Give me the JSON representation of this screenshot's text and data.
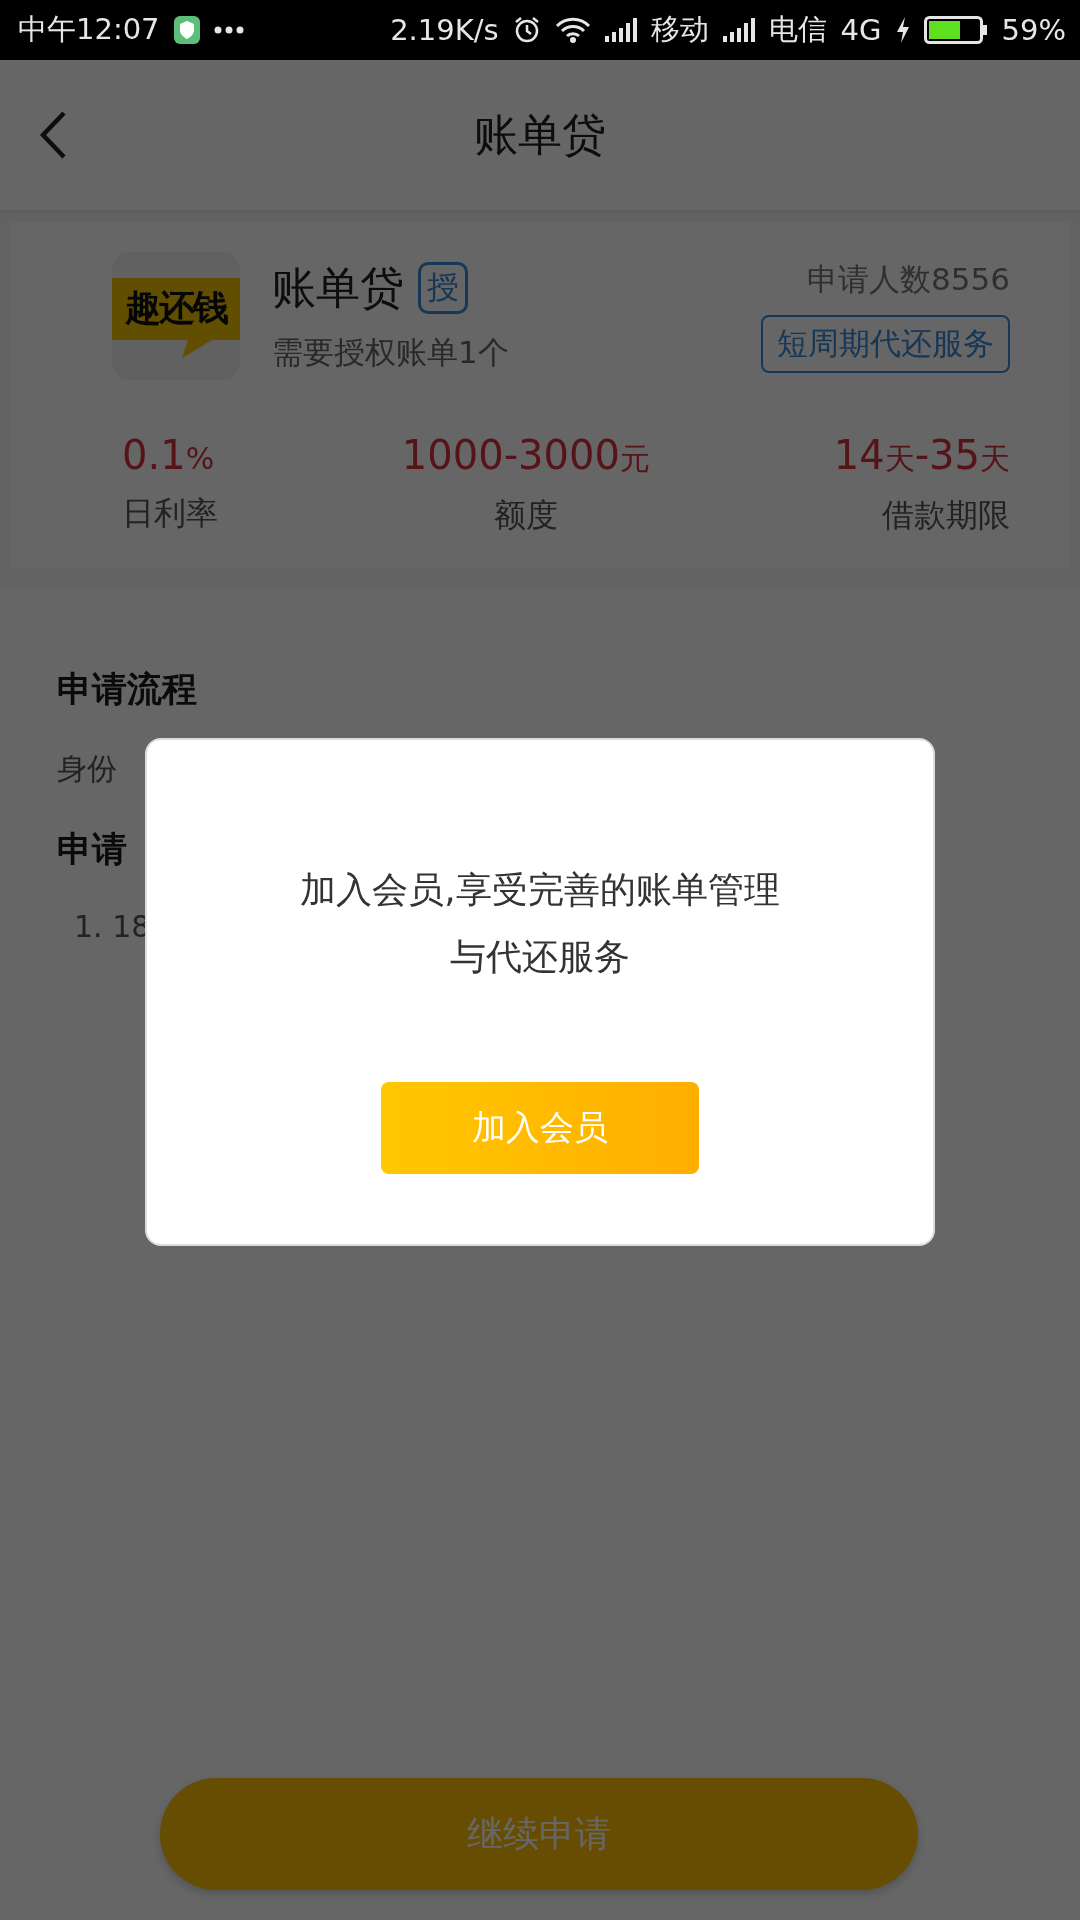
{
  "status_bar": {
    "time": "中午12:07",
    "speed": "2.19K/s",
    "carrier_1": "移动",
    "carrier_2": "电信",
    "network": "4G",
    "battery": "59%"
  },
  "header": {
    "title": "账单贷"
  },
  "product": {
    "logo_text": "趣还钱",
    "name": "账单贷",
    "badge": "授",
    "subtitle": "需要授权账单1个",
    "applicants": "申请人数8556",
    "tag": "短周期代还服务",
    "stats": [
      {
        "parts": [
          {
            "text": "0.1",
            "kind": "number"
          },
          {
            "text": "%",
            "kind": "unit"
          }
        ],
        "label": "日利率"
      },
      {
        "parts": [
          {
            "text": "1000-3000",
            "kind": "number"
          },
          {
            "text": "元",
            "kind": "unit"
          }
        ],
        "label": "额度"
      },
      {
        "parts": [
          {
            "text": "14",
            "kind": "number"
          },
          {
            "text": "天",
            "kind": "unit"
          },
          {
            "text": "-35",
            "kind": "number"
          },
          {
            "text": "天",
            "kind": "unit"
          }
        ],
        "label": "借款期限"
      }
    ]
  },
  "sections": [
    {
      "kind": "heading",
      "text": "申请流程"
    },
    {
      "kind": "body",
      "text": "身份"
    },
    {
      "kind": "heading",
      "text": "申请"
    },
    {
      "kind": "item",
      "text": "1. 18"
    }
  ],
  "dialog": {
    "message_lines": [
      "加入会员,享受完善的账单管理",
      "与代还服务"
    ],
    "button": "加入会员"
  },
  "bottom_button": "继续申请"
}
